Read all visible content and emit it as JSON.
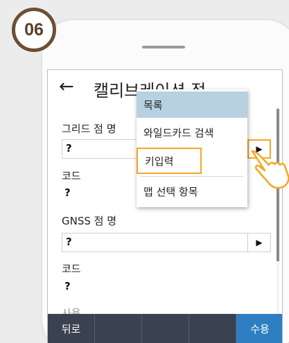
{
  "step": {
    "number": "06"
  },
  "screen": {
    "title": "캘리브레이션 점",
    "back_icon": "back-arrow-icon"
  },
  "form": {
    "grid_point_label": "그리드 점 명",
    "grid_point_value": "?",
    "code_label_1": "코드",
    "code_value_1": "?",
    "gnss_point_label": "GNSS 점 명",
    "gnss_point_value": "?",
    "code_label_2": "코드",
    "code_value_2": "?",
    "partial_label": "사용"
  },
  "dropdown": {
    "items": [
      {
        "label": "목록",
        "selected": true
      },
      {
        "label": "와일드카드 검색"
      },
      {
        "label": "키입력",
        "highlighted": true
      },
      {
        "label": "맵 선택 항목"
      }
    ]
  },
  "bottom_bar": {
    "back_label": "뒤로",
    "accept_label": "수용"
  },
  "colors": {
    "highlight": "#f5a623",
    "selected_row": "#b7d1e3",
    "bottom_bar": "#3a4150",
    "accept": "#2e7fc2",
    "badge_border": "#6b4f36"
  }
}
